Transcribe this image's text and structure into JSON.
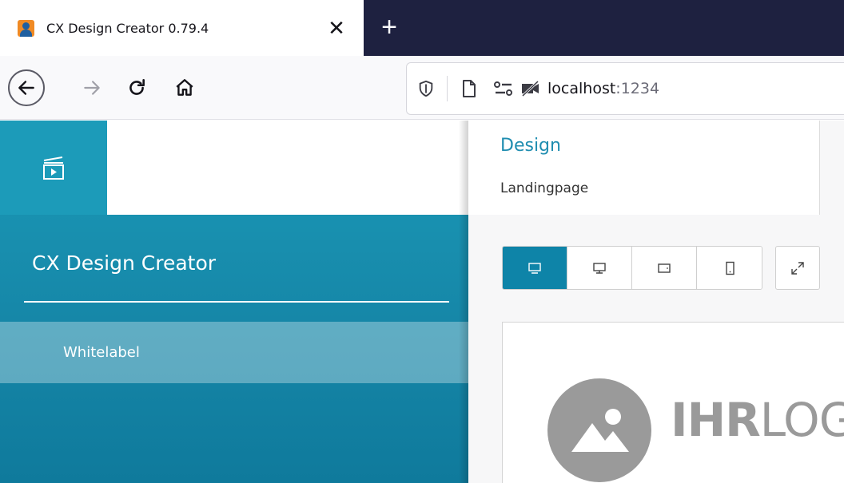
{
  "browser": {
    "tab": {
      "title": "CX Design Creator 0.79.4",
      "close_glyph": "✕",
      "favicon": "app-favicon"
    },
    "new_tab_glyph": "+",
    "nav": {
      "back_icon": "arrow-left-icon",
      "forward_icon": "arrow-right-icon",
      "reload_icon": "reload-icon",
      "home_icon": "home-icon"
    },
    "url": {
      "host": "localhost",
      "port": ":1234",
      "icons": [
        "shield-icon",
        "page-icon",
        "permissions-icon",
        "camera-blocked-icon"
      ]
    }
  },
  "sidebar": {
    "logo_icon": "clapperboard-icon",
    "title": "CX Design Creator",
    "items": [
      {
        "label": "Whitelabel",
        "active": true
      }
    ],
    "colors": {
      "accent": "#1b9ab8"
    }
  },
  "main": {
    "header": {
      "title": "Design",
      "subtitle": "Landingpage"
    },
    "device_buttons": [
      {
        "icon": "monitor-icon",
        "active": true
      },
      {
        "icon": "desktop-icon",
        "active": false
      },
      {
        "icon": "tablet-icon",
        "active": false
      },
      {
        "icon": "phone-icon",
        "active": false
      }
    ],
    "expand_icon": "expand-icon",
    "preview": {
      "logo_icon": "image-placeholder-icon",
      "logo_bold": "IHR",
      "logo_light": "LOGO"
    },
    "colors": {
      "active_button": "#0e84a8",
      "title": "#1f8db0"
    }
  }
}
